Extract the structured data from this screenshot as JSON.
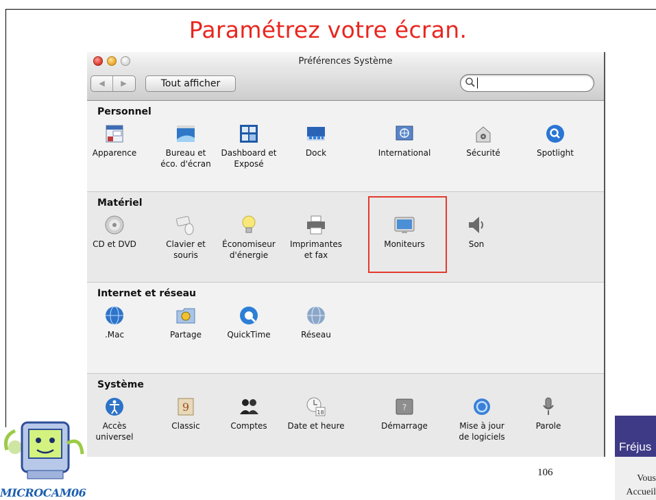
{
  "slide": {
    "title": "Paramétrez votre écran.",
    "page_number": "106"
  },
  "window": {
    "title": "Préférences Système",
    "toolbar": {
      "back_glyph": "◀",
      "forward_glyph": "▶",
      "show_all_label": "Tout afficher",
      "search_value": ""
    },
    "sections": [
      {
        "title": "Personnel",
        "items": [
          {
            "label": "Apparence",
            "icon": "appearance-icon"
          },
          {
            "label": "Bureau et\néco. d'écran",
            "icon": "desktop-screensaver-icon"
          },
          {
            "label": "Dashboard et\nExposé",
            "icon": "dashboard-expose-icon"
          },
          {
            "label": "Dock",
            "icon": "dock-icon"
          },
          {
            "label": "International",
            "icon": "international-flag-icon"
          },
          {
            "label": "Sécurité",
            "icon": "security-house-icon"
          },
          {
            "label": "Spotlight",
            "icon": "spotlight-icon"
          }
        ]
      },
      {
        "title": "Matériel",
        "items": [
          {
            "label": "CD et DVD",
            "icon": "cd-dvd-icon"
          },
          {
            "label": "Clavier et\nsouris",
            "icon": "keyboard-mouse-icon"
          },
          {
            "label": "Économiseur\nd'énergie",
            "icon": "energy-bulb-icon"
          },
          {
            "label": "Imprimantes\net fax",
            "icon": "printer-icon"
          },
          {
            "label": "Moniteurs",
            "icon": "monitor-icon"
          },
          {
            "label": "Son",
            "icon": "speaker-icon"
          }
        ]
      },
      {
        "title": "Internet et réseau",
        "items": [
          {
            "label": ".Mac",
            "icon": "dotmac-globe-icon"
          },
          {
            "label": "Partage",
            "icon": "sharing-folder-icon"
          },
          {
            "label": "QuickTime",
            "icon": "quicktime-icon"
          },
          {
            "label": "Réseau",
            "icon": "network-globe-icon"
          }
        ]
      },
      {
        "title": "Système",
        "items": [
          {
            "label": "Accès\nuniversel",
            "icon": "universal-access-icon"
          },
          {
            "label": "Classic",
            "icon": "classic-icon"
          },
          {
            "label": "Comptes",
            "icon": "accounts-icon"
          },
          {
            "label": "Date et heure",
            "icon": "date-time-icon"
          },
          {
            "label": "Démarrage",
            "icon": "startup-disk-icon"
          },
          {
            "label": "Mise à jour\nde logiciels",
            "icon": "software-update-icon"
          },
          {
            "label": "Parole",
            "icon": "speech-microphone-icon"
          }
        ]
      }
    ],
    "highlighted_item": "Moniteurs"
  },
  "logos": {
    "left_text": "MICROCAM06",
    "right_name": "Fréjus",
    "right_line1": "Vous",
    "right_line2": "Accueil"
  },
  "colors": {
    "title_red": "#e8261f",
    "highlight_red": "#e5392c",
    "microcam_blue": "#1d5fae",
    "frejus_purple": "#3e3a86"
  }
}
